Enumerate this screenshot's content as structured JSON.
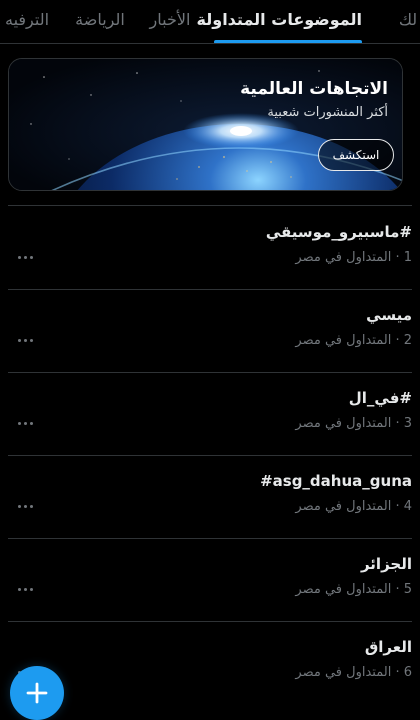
{
  "tabs": [
    {
      "label": "لك",
      "active": false
    },
    {
      "label": "الموضوعات المتداولة",
      "active": true
    },
    {
      "label": "الأخبار",
      "active": false
    },
    {
      "label": "الرياضة",
      "active": false
    },
    {
      "label": "الترفيه",
      "active": false
    }
  ],
  "banner": {
    "title": "الاتجاهات العالمية",
    "subtitle": "أكثر المنشورات شعبية",
    "button_label": "استكشف"
  },
  "trends": [
    {
      "rank": "1",
      "context": "المتداول في مصر",
      "name": "#ماسبيرو_موسيقي"
    },
    {
      "rank": "2",
      "context": "المتداول في مصر",
      "name": "ميسي"
    },
    {
      "rank": "3",
      "context": "المتداول في مصر",
      "name": "#في_ال"
    },
    {
      "rank": "4",
      "context": "المتداول في مصر",
      "name": "#asg_dahua_guna"
    },
    {
      "rank": "5",
      "context": "المتداول في مصر",
      "name": "الجزائر"
    },
    {
      "rank": "6",
      "context": "المتداول في مصر",
      "name": "العراق"
    }
  ],
  "rank_separator": " · ",
  "fab": {
    "icon": "plus-icon"
  },
  "icons": {
    "more": "more-horizontal-icon",
    "earth": "earth-image"
  },
  "colors": {
    "accent": "#1d9bf0",
    "background": "#000000",
    "divider": "#2f3336",
    "muted": "#71767b"
  }
}
